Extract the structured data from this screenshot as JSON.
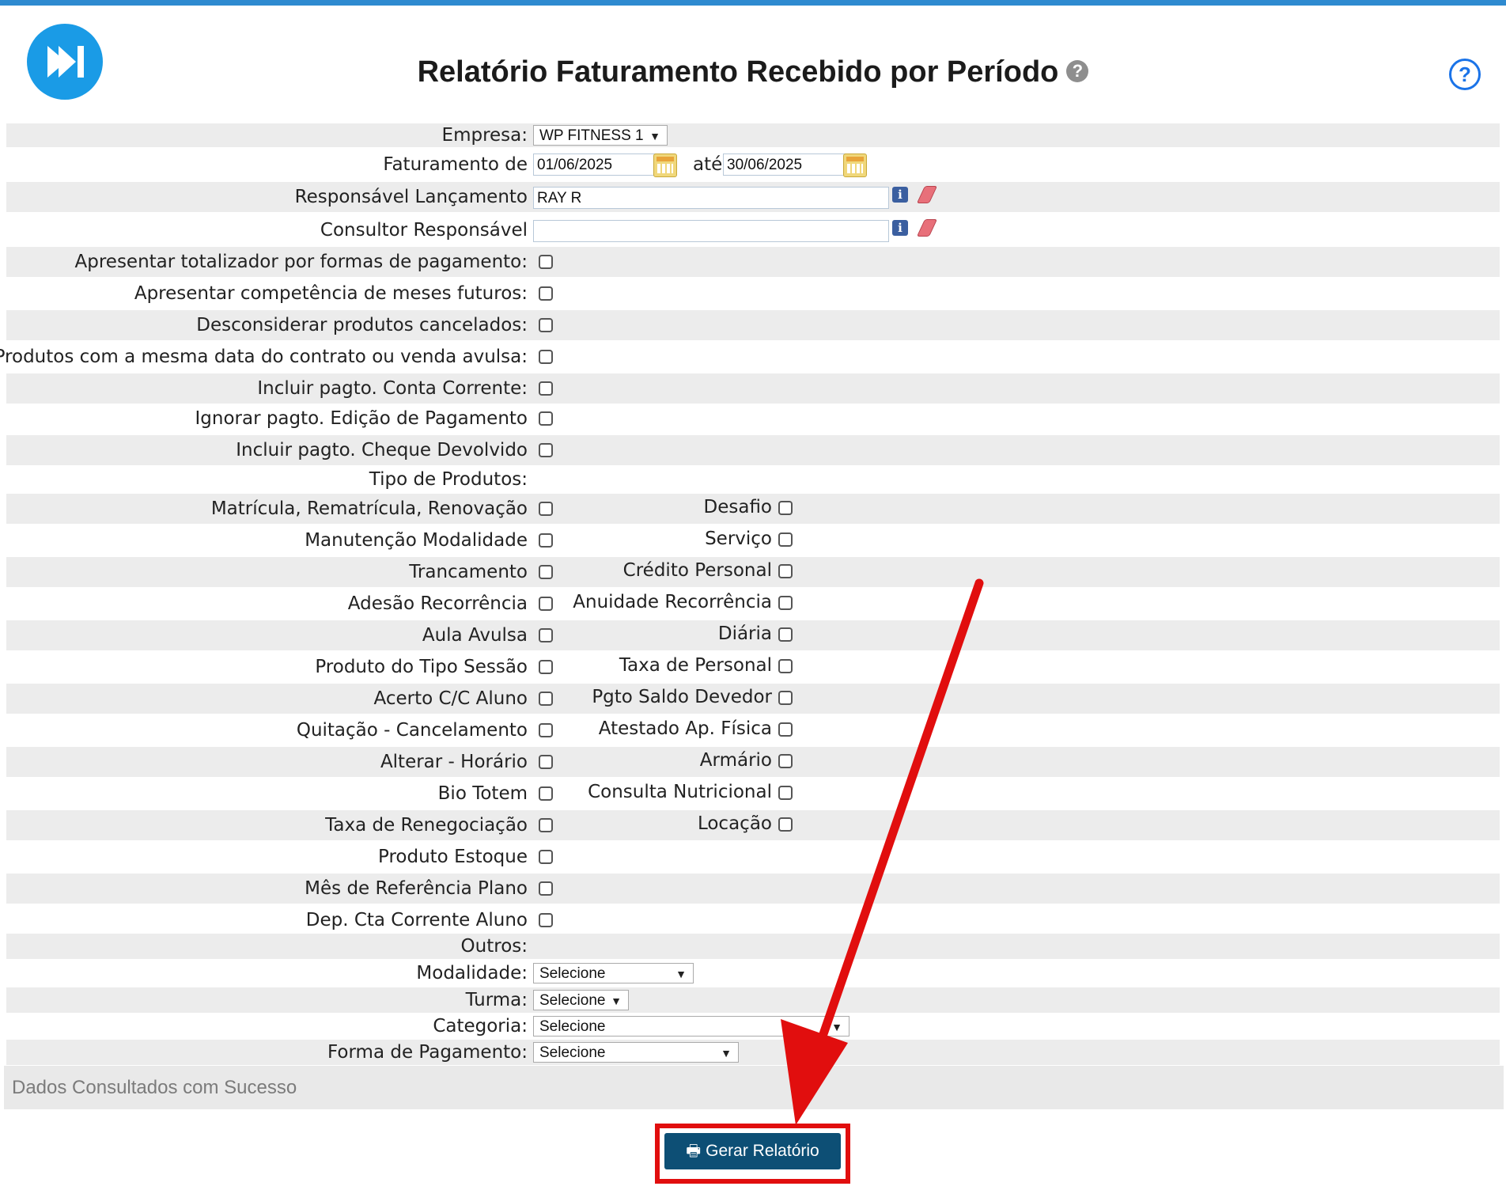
{
  "page": {
    "title": "Relatório Faturamento Recebido por Período",
    "help_badge": "?"
  },
  "help_icon": "?",
  "empresa": {
    "label": "Empresa:",
    "value": "WP FITNESS 1"
  },
  "faturamento": {
    "label": "Faturamento de",
    "from": "01/06/2025",
    "to_label": "até",
    "to": "30/06/2025"
  },
  "responsavel_lancamento": {
    "label": "Responsável Lançamento",
    "value": "RAY R"
  },
  "consultor_responsavel": {
    "label": "Consultor Responsável",
    "value": ""
  },
  "options": [
    "Apresentar totalizador por formas de pagamento:",
    "Apresentar competência de meses futuros:",
    "Desconsiderar produtos cancelados:",
    "Produtos com a mesma data do contrato ou venda avulsa:",
    "Incluir pagto. Conta Corrente:",
    "Ignorar pagto. Edição de Pagamento",
    "Incluir pagto. Cheque Devolvido"
  ],
  "tipo_produtos_label": "Tipo de Produtos:",
  "products_left": [
    "Matrícula, Rematrícula, Renovação",
    "Manutenção Modalidade",
    "Trancamento",
    "Adesão Recorrência",
    "Aula Avulsa",
    "Produto do Tipo Sessão",
    "Acerto C/C Aluno",
    "Quitação - Cancelamento",
    "Alterar - Horário",
    "Bio Totem",
    "Taxa de Renegociação",
    "Produto Estoque",
    "Mês de Referência Plano",
    "Dep. Cta Corrente Aluno"
  ],
  "products_right": [
    "Desafio",
    "Serviço",
    "Crédito Personal",
    "Anuidade Recorrência",
    "Diária",
    "Taxa de Personal",
    "Pgto Saldo Devedor",
    "Atestado Ap. Física",
    "Armário",
    "Consulta Nutricional",
    "Locação"
  ],
  "outros_label": "Outros:",
  "modalidade": {
    "label": "Modalidade:",
    "value": "Selecione"
  },
  "turma": {
    "label": "Turma:",
    "value": "Selecione"
  },
  "categoria": {
    "label": "Categoria:",
    "value": "Selecione"
  },
  "forma_pagamento": {
    "label": "Forma de Pagamento:",
    "value": "Selecione"
  },
  "status_message": "Dados Consultados com Sucesso",
  "button": {
    "label": "Gerar Relatório"
  },
  "colors": {
    "topbar": "#2e8ad0",
    "logo": "#1a9be6",
    "button": "#0d4f75",
    "annotation": "#e10e0e"
  }
}
